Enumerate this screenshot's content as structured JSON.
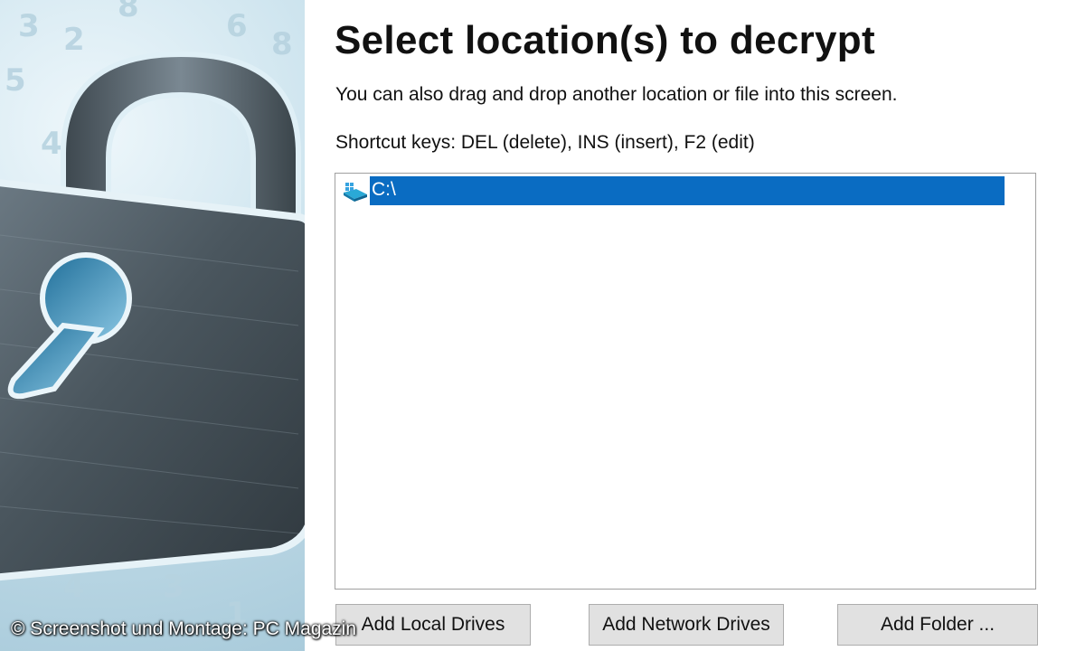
{
  "page": {
    "title": "Select location(s) to decrypt",
    "subtitle": "You can also drag and drop another location or file into this screen.",
    "shortcuts": "Shortcut keys: DEL (delete), INS (insert), F2 (edit)"
  },
  "locations": {
    "items": [
      {
        "label": "C:\\",
        "icon": "drive-icon",
        "selected": true
      }
    ]
  },
  "buttons": {
    "add_local": "Add Local Drives",
    "add_network": "Add Network Drives",
    "add_folder": "Add Folder ..."
  },
  "credit": "© Screenshot und Montage: PC Magazin",
  "colors": {
    "selection": "#0a6cc2",
    "button_bg": "#e1e1e1",
    "list_border": "#a0a0a0"
  }
}
